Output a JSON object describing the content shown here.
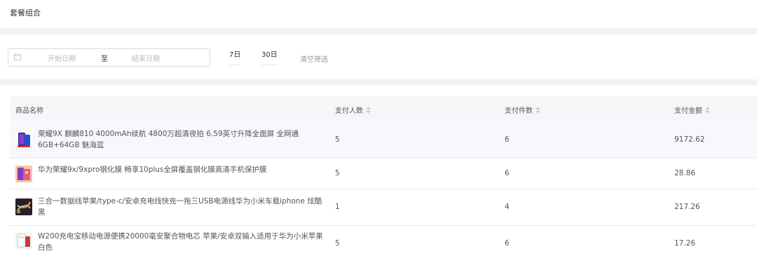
{
  "header": {
    "title": "套餐组合"
  },
  "filter": {
    "start_placeholder": "开始日期",
    "separator": "至",
    "end_placeholder": "结束日期",
    "quick_7d": "7日",
    "quick_30d": "30日",
    "clear": "清空筛选"
  },
  "table": {
    "columns": [
      "商品名称",
      "支付人数",
      "支付件数",
      "支付金额"
    ],
    "rows": [
      {
        "name": "荣耀9X 麒麟810 4000mAh续航 4800万超清夜拍 6.59英寸升降全面屏 全网通6GB+64GB 魅海蓝",
        "buyers": "5",
        "items": "6",
        "amount": "9172.62",
        "thumb": "phone-thumbnail"
      },
      {
        "name": "华为荣耀9x/9xpro钢化膜 畅享10plus全屏覆盖钢化膜高清手机保护膜",
        "buyers": "5",
        "items": "6",
        "amount": "28.86",
        "thumb": "screen-protector-thumbnail"
      },
      {
        "name": "三合一数据线苹果/type-c/安卓充电线快充一拖三USB电源线华为小米车载iphone 炫酷黑",
        "buyers": "1",
        "items": "4",
        "amount": "217.26",
        "thumb": "cable-thumbnail"
      },
      {
        "name": "W200充电宝移动电源便携20000毫安聚合物电芯 苹果/安卓双输入适用于华为小米苹果白色",
        "buyers": "5",
        "items": "6",
        "amount": "17.26",
        "thumb": "power-bank-thumbnail"
      }
    ]
  },
  "colors": {
    "page_bg": "#f0f2f5",
    "header_row_bg": "#f5f6f8",
    "highlight_row_bg": "#f7f8fb",
    "text": "#555555"
  }
}
